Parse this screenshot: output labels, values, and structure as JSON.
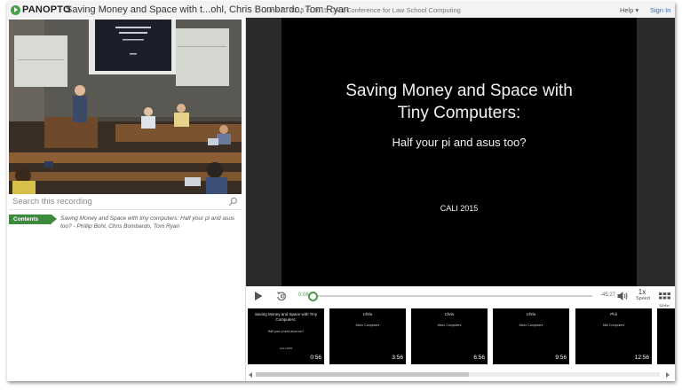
{
  "header": {
    "logo": "PANOPTO",
    "title": "Saving Money and Space with t...ohl, Chris Bombardo, Tom Ryan",
    "subtitle": "June 20 2015 in 2015 CALI Conference for Law School Computing",
    "help": "Help ▾",
    "signin": "Sign In"
  },
  "search": {
    "placeholder": "Search this recording"
  },
  "contents": {
    "tab_label": "Contents",
    "entry": "Saving Money and Space with tiny computers: Half your pi and asus too? - Phillip Bohl, Chris Bombardo, Tom Ryan"
  },
  "slide": {
    "title_line1": "Saving Money and Space with",
    "title_line2": "Tiny Computers:",
    "subtitle": "Half your pi and asus too?",
    "footer": "CALI 2015"
  },
  "controls": {
    "current_time": "0:08",
    "remaining_time": "-45:27",
    "progress_fraction": 0.003,
    "speed_value": "1x",
    "speed_label": "Speed",
    "hide_label": "Hide"
  },
  "thumbnails": [
    {
      "title": "Saving Money and Space with Tiny Computers:",
      "sub": "Half your pi and asus too?",
      "foot": "CALI 2015",
      "time": "0:56"
    },
    {
      "title": "Chris",
      "sub": "Micro Computers",
      "foot": "",
      "time": "3:56"
    },
    {
      "title": "Chris",
      "sub": "Micro Computers",
      "foot": "",
      "time": "6:56"
    },
    {
      "title": "Chris",
      "sub": "Micro Computers",
      "foot": "",
      "time": "9:56"
    },
    {
      "title": "Phil",
      "sub": "Mini Computers",
      "foot": "",
      "time": "12:56"
    }
  ],
  "colors": {
    "accent_green": "#3d8a3f",
    "link_blue": "#2b6cc4",
    "slide_background": "#000000"
  }
}
